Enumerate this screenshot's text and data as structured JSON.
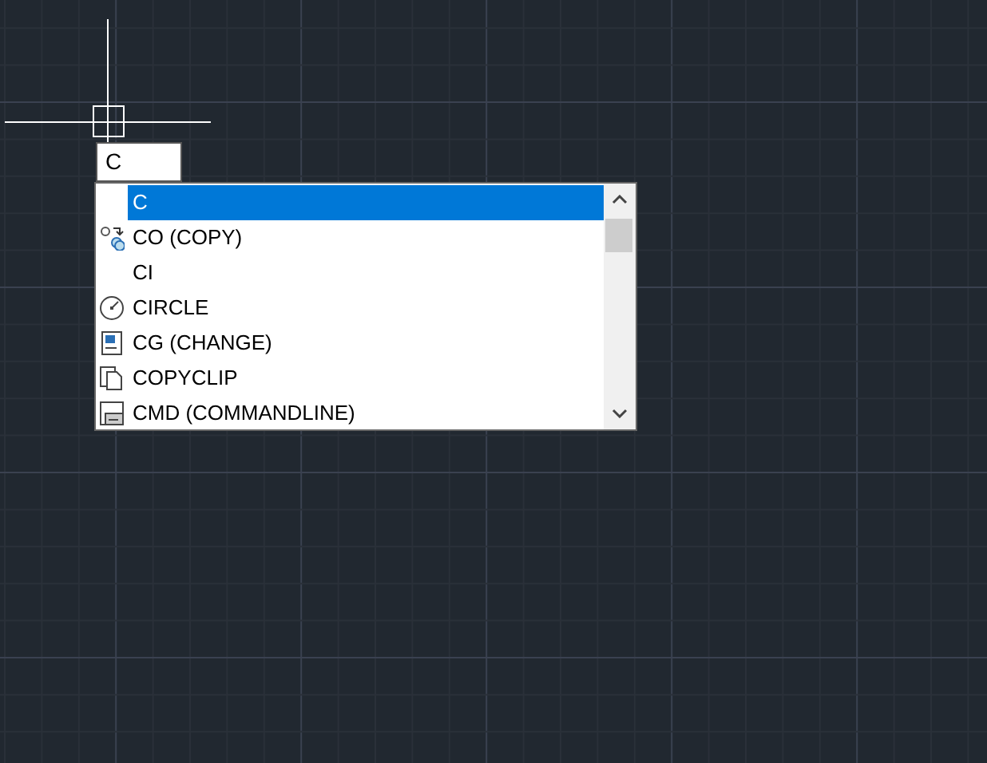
{
  "command_input": {
    "value": "C"
  },
  "suggestions": [
    {
      "label": "C",
      "kind": "plain",
      "selected": true
    },
    {
      "label": "CO (COPY)",
      "kind": "copy",
      "selected": false
    },
    {
      "label": "CI",
      "kind": "plain",
      "selected": false
    },
    {
      "label": "CIRCLE",
      "kind": "circle",
      "selected": false
    },
    {
      "label": "CG (CHANGE)",
      "kind": "change",
      "selected": false
    },
    {
      "label": "COPYCLIP",
      "kind": "clip",
      "selected": false
    },
    {
      "label": "CMD (COMMANDLINE)",
      "kind": "console",
      "selected": false
    }
  ]
}
